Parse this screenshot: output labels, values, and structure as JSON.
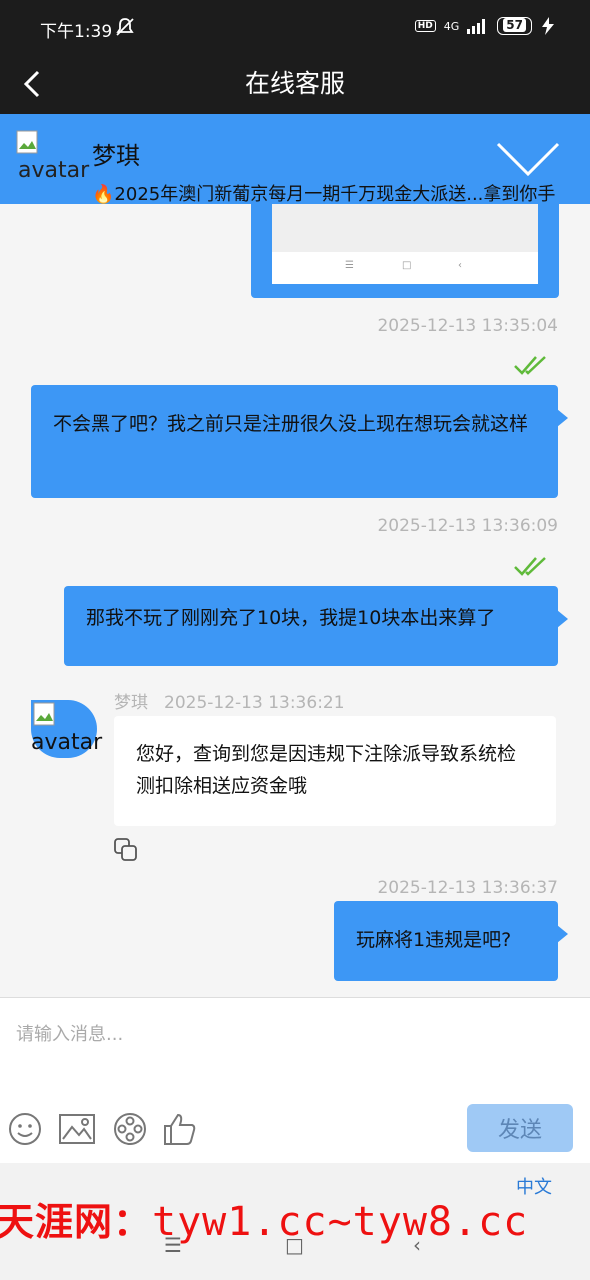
{
  "status": {
    "time": "下午1:39",
    "hd": "HD",
    "signal": "4G",
    "battery": "57"
  },
  "nav": {
    "title": "在线客服"
  },
  "banner": {
    "avatar_alt": "avatar",
    "name": "梦琪",
    "notice": "🔥2025年澳门新葡京每月一期千万现金大派送...拿到你手"
  },
  "messages": [
    {
      "time": "2025-12-13 13:35:04",
      "text": "不会黑了吧？我之前只是注册很久没上现在想玩会就这样"
    },
    {
      "time": "2025-12-13 13:36:09",
      "text": "那我不玩了刚刚充了10块，我提10块本出来算了"
    },
    {
      "sender": "梦琪",
      "time": "2025-12-13 13:36:21",
      "avatar_alt": "avatar",
      "text": "您好，查询到您是因违规下注除派导致系统检测扣除相送应资金哦"
    },
    {
      "time": "2025-12-13 13:36:37",
      "text": "玩麻将1违规是吧?"
    }
  ],
  "input": {
    "placeholder": "请输入消息...",
    "send_label": "发送"
  },
  "footer": {
    "lang": "中文",
    "watermark_cn": "天涯网：",
    "watermark_url": "tyw1.cc~tyw8.cc"
  },
  "colors": {
    "accent": "#3d97f5",
    "read_check": "#5fba3a",
    "watermark": "#ee1111"
  }
}
